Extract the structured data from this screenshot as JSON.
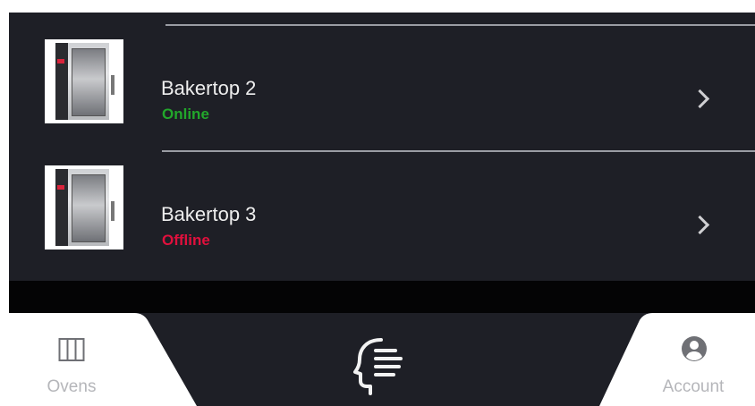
{
  "ovens": [
    {
      "name": "Bakertop 2",
      "status": "Online",
      "status_color": "#22a72b"
    },
    {
      "name": "Bakertop 3",
      "status": "Offline",
      "status_color": "#e0103d"
    }
  ],
  "nav": {
    "ovens_label": "Ovens",
    "account_label": "Account",
    "ovens_icon": "ovens-columns-icon",
    "center_icon": "voice-assistant-head-icon",
    "account_icon": "account-person-icon"
  },
  "colors": {
    "background": "#1e1f26",
    "nav_light": "#ffffff",
    "online": "#22a72b",
    "offline": "#e0103d"
  }
}
